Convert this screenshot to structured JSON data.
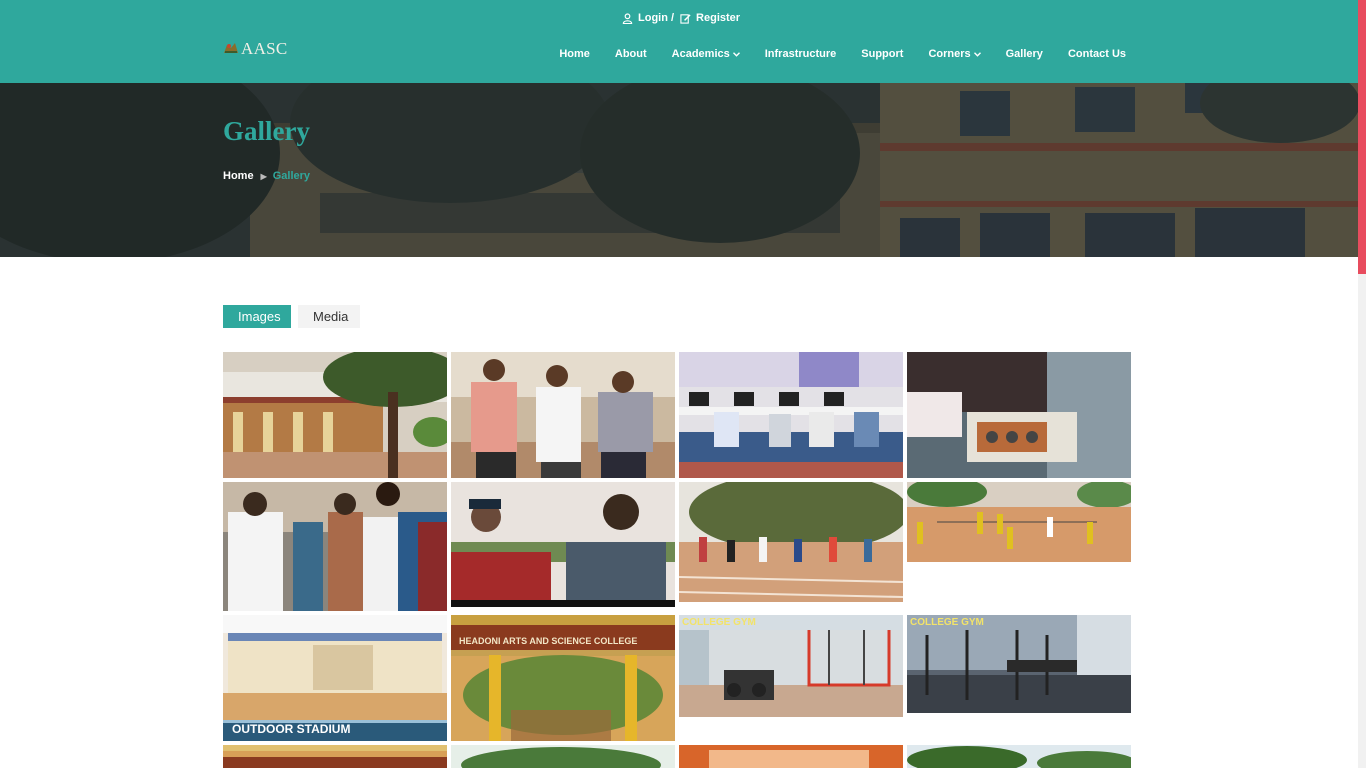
{
  "topbar": {
    "login_label": "Login /",
    "register_label": "Register"
  },
  "brand": {
    "name": "AASC"
  },
  "nav": {
    "items": [
      {
        "label": "Home",
        "dropdown": false
      },
      {
        "label": "About",
        "dropdown": false
      },
      {
        "label": "Academics",
        "dropdown": true
      },
      {
        "label": "Infrastructure",
        "dropdown": false
      },
      {
        "label": "Support",
        "dropdown": false
      },
      {
        "label": "Corners",
        "dropdown": true
      },
      {
        "label": "Gallery",
        "dropdown": false
      },
      {
        "label": "Contact Us",
        "dropdown": false
      }
    ]
  },
  "hero": {
    "title": "Gallery"
  },
  "breadcrumb": {
    "home": "Home",
    "current": "Gallery"
  },
  "tabs": {
    "images": "Images",
    "media": "Media"
  },
  "gallery": {
    "captions": {
      "outdoor_stadium": "OUTDOOR STADIUM",
      "college_gym": "COLLEGE GYM",
      "college_name_sign": "HEADONI ARTS AND SCIENCE COLLEGE"
    }
  },
  "colors": {
    "accent": "#2fa89d",
    "scroll_thumb": "#e84c5e",
    "text_dark": "#333333"
  }
}
